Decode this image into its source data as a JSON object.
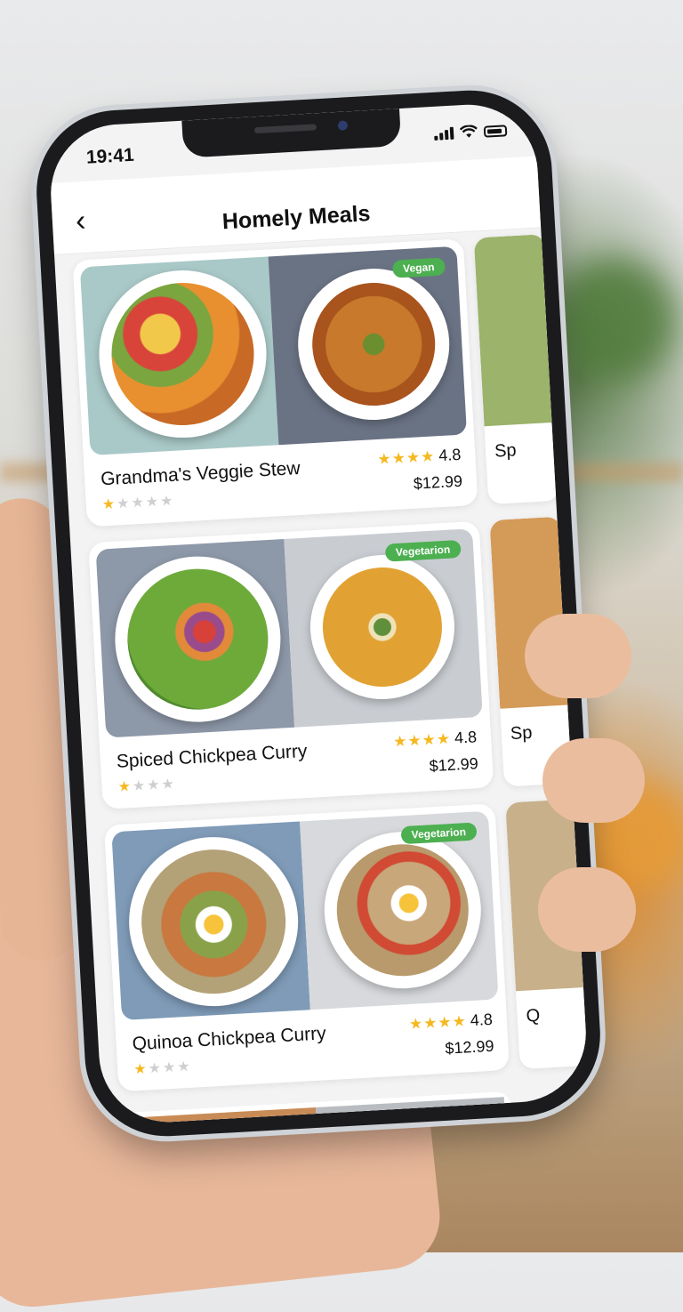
{
  "status_bar": {
    "time": "19:41"
  },
  "nav": {
    "back_icon": "chevron-left-icon",
    "title": "Homely Meals"
  },
  "colors": {
    "badge_green": "#4caf50",
    "star_gold": "#f5b920",
    "star_gray": "#cfcfcf"
  },
  "meals": [
    {
      "name": "Grandma's Veggie Stew",
      "badge": "Vegan",
      "rating": "4.8",
      "price": "$12.99",
      "top_stars": 4,
      "user_stars": 1,
      "user_stars_total": 5,
      "peek_text": "Sp"
    },
    {
      "name": "Spiced Chickpea Curry",
      "badge": "Vegetarion",
      "rating": "4.8",
      "price": "$12.99",
      "top_stars": 4,
      "user_stars": 1,
      "user_stars_total": 4,
      "peek_text": "Sp"
    },
    {
      "name": "Quinoa Chickpea Curry",
      "badge": "Vegetarion",
      "rating": "4.8",
      "price": "$12.99",
      "top_stars": 4,
      "user_stars": 1,
      "user_stars_total": 4,
      "peek_text": "Q"
    }
  ]
}
